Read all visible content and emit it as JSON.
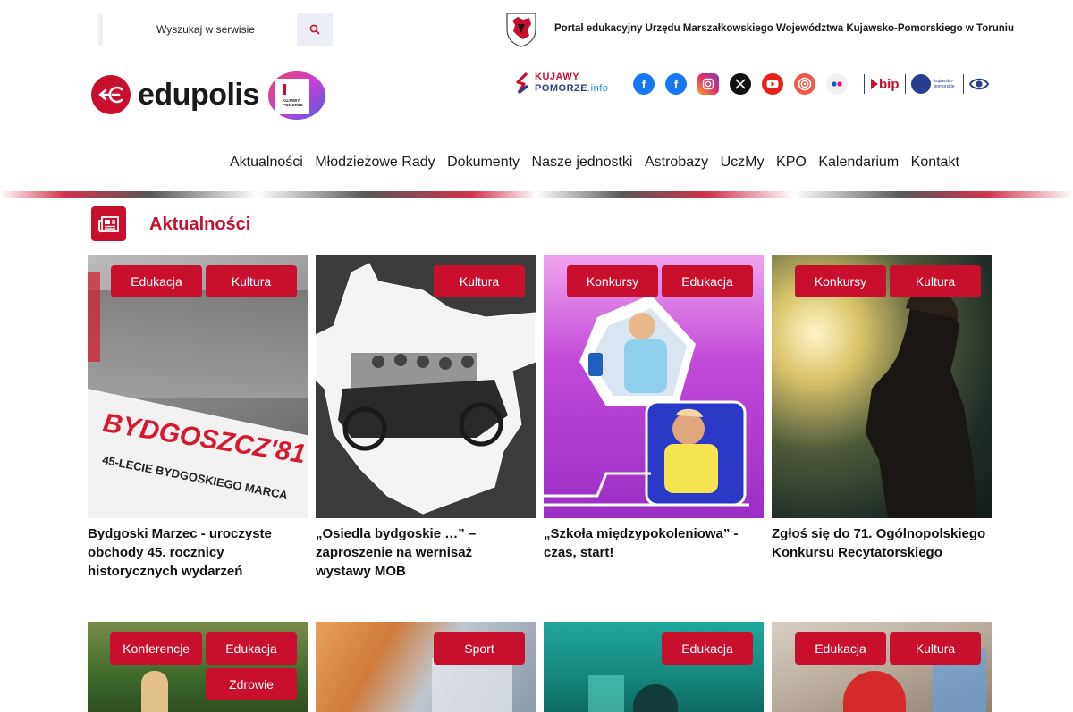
{
  "search": {
    "placeholder": "Wyszukaj w serwisie"
  },
  "portal": {
    "text": "Portal edukacyjny Urzędu Marszałkowskiego Województwa Kujawsko-Pomorskiego w Toruniu"
  },
  "logo": {
    "text": "edupolis",
    "badge_line1": "KUJAWY",
    "badge_line2": "POMORZE"
  },
  "kp_info": {
    "line1": "KUJAWY",
    "line2": "POMORZE",
    "suffix": ".info"
  },
  "social_icons": [
    "facebook-icon",
    "facebook-icon",
    "instagram-icon",
    "x-icon",
    "youtube-icon",
    "podcast-icon",
    "flickr-icon"
  ],
  "bip": {
    "label": "bip"
  },
  "kpw": {
    "label": "kujawsko-pomorskie"
  },
  "nav": [
    "Aktualności",
    "Młodzieżowe Rady",
    "Dokumenty",
    "Nasze jednostki",
    "Astrobazy",
    "UczMy",
    "KPO",
    "Kalendarium",
    "Kontakt"
  ],
  "section": {
    "title": "Aktualności"
  },
  "cards": [
    {
      "tags": [
        "Edukacja",
        "Kultura"
      ],
      "title": "Bydgoski Marzec - uroczyste obchody 45. rocznicy historycznych wydarzeń",
      "img_text1": "BYDGOSZCZ'81",
      "img_text2": "45-LECIE BYDGOSKIEGO MARCA"
    },
    {
      "tags": [
        "Kultura"
      ],
      "title": "„Osiedla bydgoskie …” – zaproszenie na wernisaż wystawy MOB"
    },
    {
      "tags": [
        "Konkursy",
        "Edukacja"
      ],
      "title": "„Szkoła międzypokoleniowa” - czas, start!"
    },
    {
      "tags": [
        "Konkursy",
        "Kultura"
      ],
      "title": "Zgłoś się do 71. Ogólnopolskiego Konkursu Recytatorskiego"
    },
    {
      "tags": [
        "Konferencje",
        "Edukacja",
        "Zdrowie"
      ]
    },
    {
      "tags": [
        "Sport"
      ]
    },
    {
      "tags": [
        "Edukacja"
      ]
    },
    {
      "tags": [
        "Edukacja",
        "Kultura"
      ]
    }
  ],
  "colors": {
    "brand_red": "#c8102e",
    "brand_blue": "#2a3e8f"
  }
}
